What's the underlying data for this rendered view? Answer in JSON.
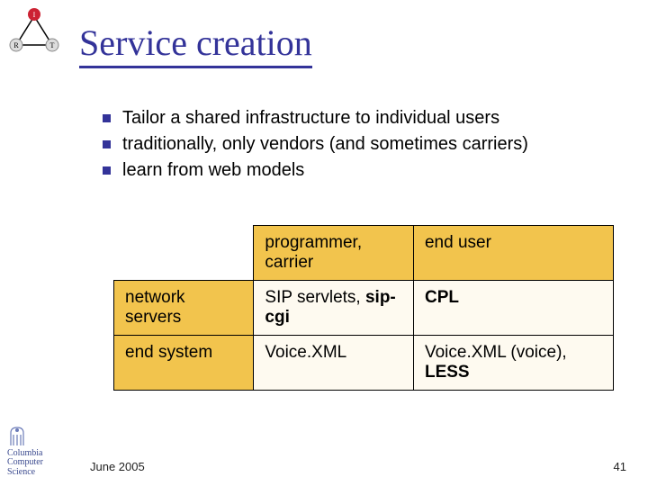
{
  "logo_irt": {
    "top": "I",
    "left": "R",
    "right": "T"
  },
  "title": "Service creation",
  "bullets": [
    "Tailor a shared infrastructure to individual users",
    "traditionally, only vendors (and sometimes carriers)",
    "learn from web models"
  ],
  "table": {
    "col_headers": [
      "programmer, carrier",
      "end user"
    ],
    "rows": [
      {
        "header": "network servers",
        "cells": [
          {
            "plain": "SIP servlets, ",
            "bold": "sip-cgi"
          },
          {
            "bold": "CPL"
          }
        ]
      },
      {
        "header": "end system",
        "cells": [
          {
            "plain": "Voice.XML"
          },
          {
            "plain": "Voice.XML (voice), ",
            "bold": "LESS"
          }
        ]
      }
    ]
  },
  "footer": {
    "date": "June 2005",
    "page": "41"
  },
  "cs_logo": {
    "line1": "Columbia",
    "line2": "Computer",
    "line3": "Science"
  }
}
